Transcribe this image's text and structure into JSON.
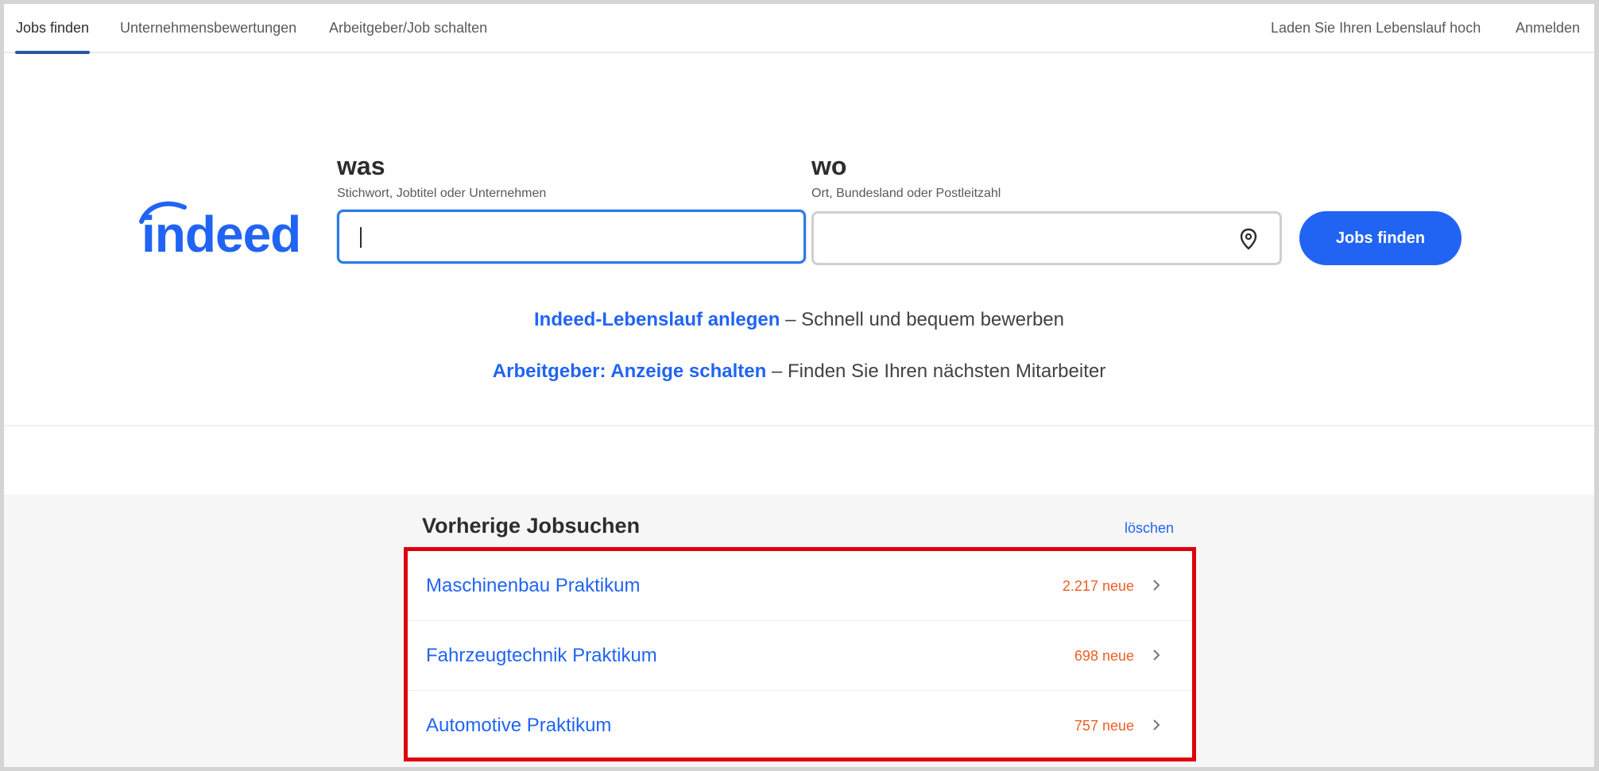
{
  "nav": {
    "left": [
      "Jobs finden",
      "Unternehmensbewertungen",
      "Arbeitgeber/Job schalten"
    ],
    "right": [
      "Laden Sie Ihren Lebenslauf hoch",
      "Anmelden"
    ]
  },
  "brand": {
    "logo_text": "indeed",
    "color": "#2164f3"
  },
  "search": {
    "what_title": "was",
    "what_sub": "Stichwort, Jobtitel oder Unternehmen",
    "what_value": "",
    "where_title": "wo",
    "where_sub": "Ort, Bundesland oder Postleitzahl",
    "where_value": "",
    "button": "Jobs finden"
  },
  "promos": [
    {
      "link": "Indeed-Lebenslauf anlegen",
      "sep": "–",
      "text": "Schnell und bequem bewerben"
    },
    {
      "link": "Arbeitgeber: Anzeige schalten",
      "sep": "–",
      "text": "Finden Sie Ihren nächsten Mitarbeiter"
    }
  ],
  "recent": {
    "title": "Vorherige Jobsuchen",
    "clear": "löschen",
    "items": [
      {
        "label": "Maschinenbau Praktikum",
        "count": "2.217 neue"
      },
      {
        "label": "Fahrzeugtechnik Praktikum",
        "count": "698 neue"
      },
      {
        "label": "Automotive Praktikum",
        "count": "757 neue"
      }
    ]
  },
  "colors": {
    "accent": "#2164f3",
    "count": "#f15d24",
    "highlight_box": "#e0000a"
  }
}
